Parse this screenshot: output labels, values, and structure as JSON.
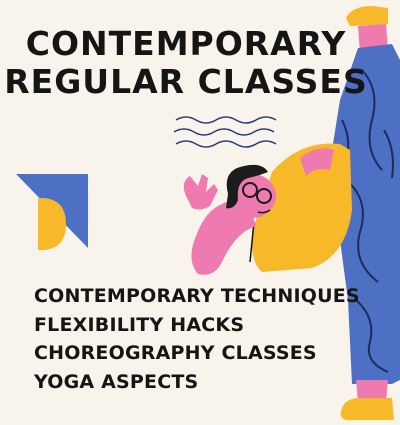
{
  "title": {
    "line1": "CONTEMPORARY",
    "line2": "REGULAR CLASSES"
  },
  "features": [
    "CONTEMPORARY TECHNIQUES",
    "FLEXIBILITY HACKS",
    "CHOREOGRAPHY CLASSES",
    "YOGA ASPECTS"
  ],
  "colors": {
    "background": "#f8f4ec",
    "text": "#151515",
    "shirt": "#f7b82a",
    "pants": "#4d6fc4",
    "skin": "#ee7ab0",
    "hair": "#1c1c1c",
    "shape_blue": "#4d6fc4",
    "shape_yellow": "#f7b82a"
  }
}
